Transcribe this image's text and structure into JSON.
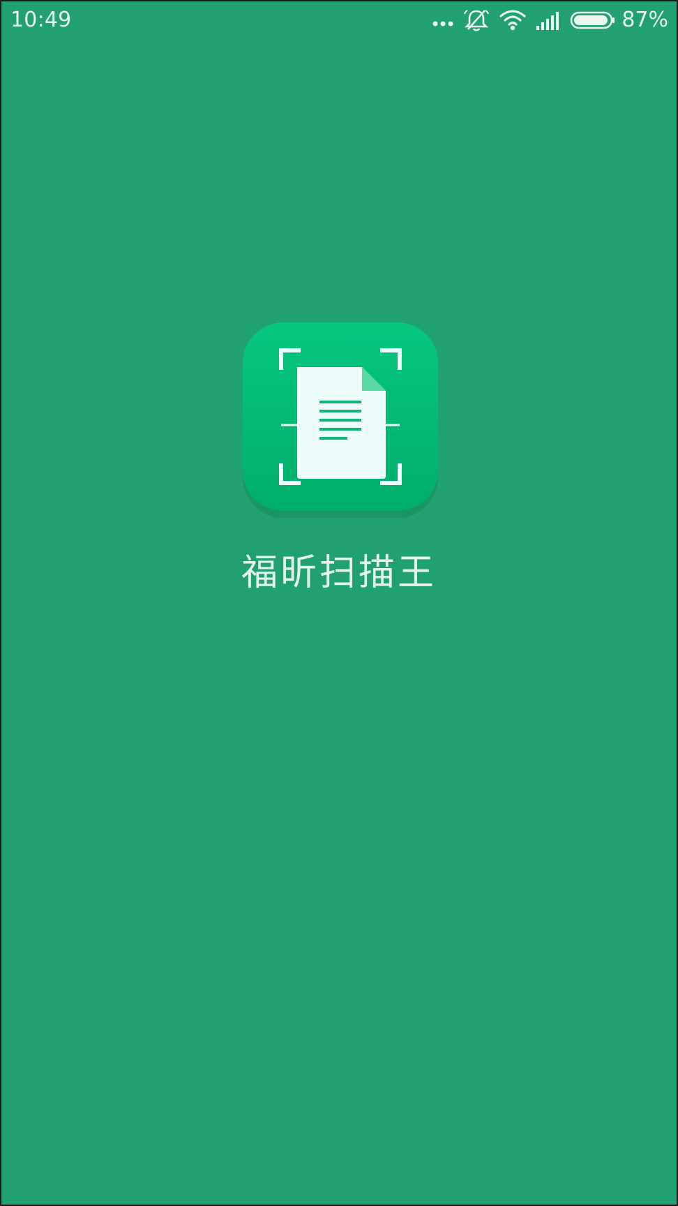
{
  "colors": {
    "background": "#21a071",
    "status_text": "#e9f7ef",
    "app_icon_top": "#07c77f",
    "app_icon_bottom": "#00ae6a",
    "document_paper": "#ecfdfb",
    "document_lines": "#12b574"
  },
  "status_bar": {
    "time": "10:49",
    "icons": [
      "more-dots-icon",
      "notifications-muted-icon",
      "wifi-icon",
      "cellular-signal-icon",
      "battery-icon"
    ],
    "battery_percent": "87%"
  },
  "splash": {
    "app_icon": "document-scan-icon",
    "app_name": "福昕扫描王"
  }
}
